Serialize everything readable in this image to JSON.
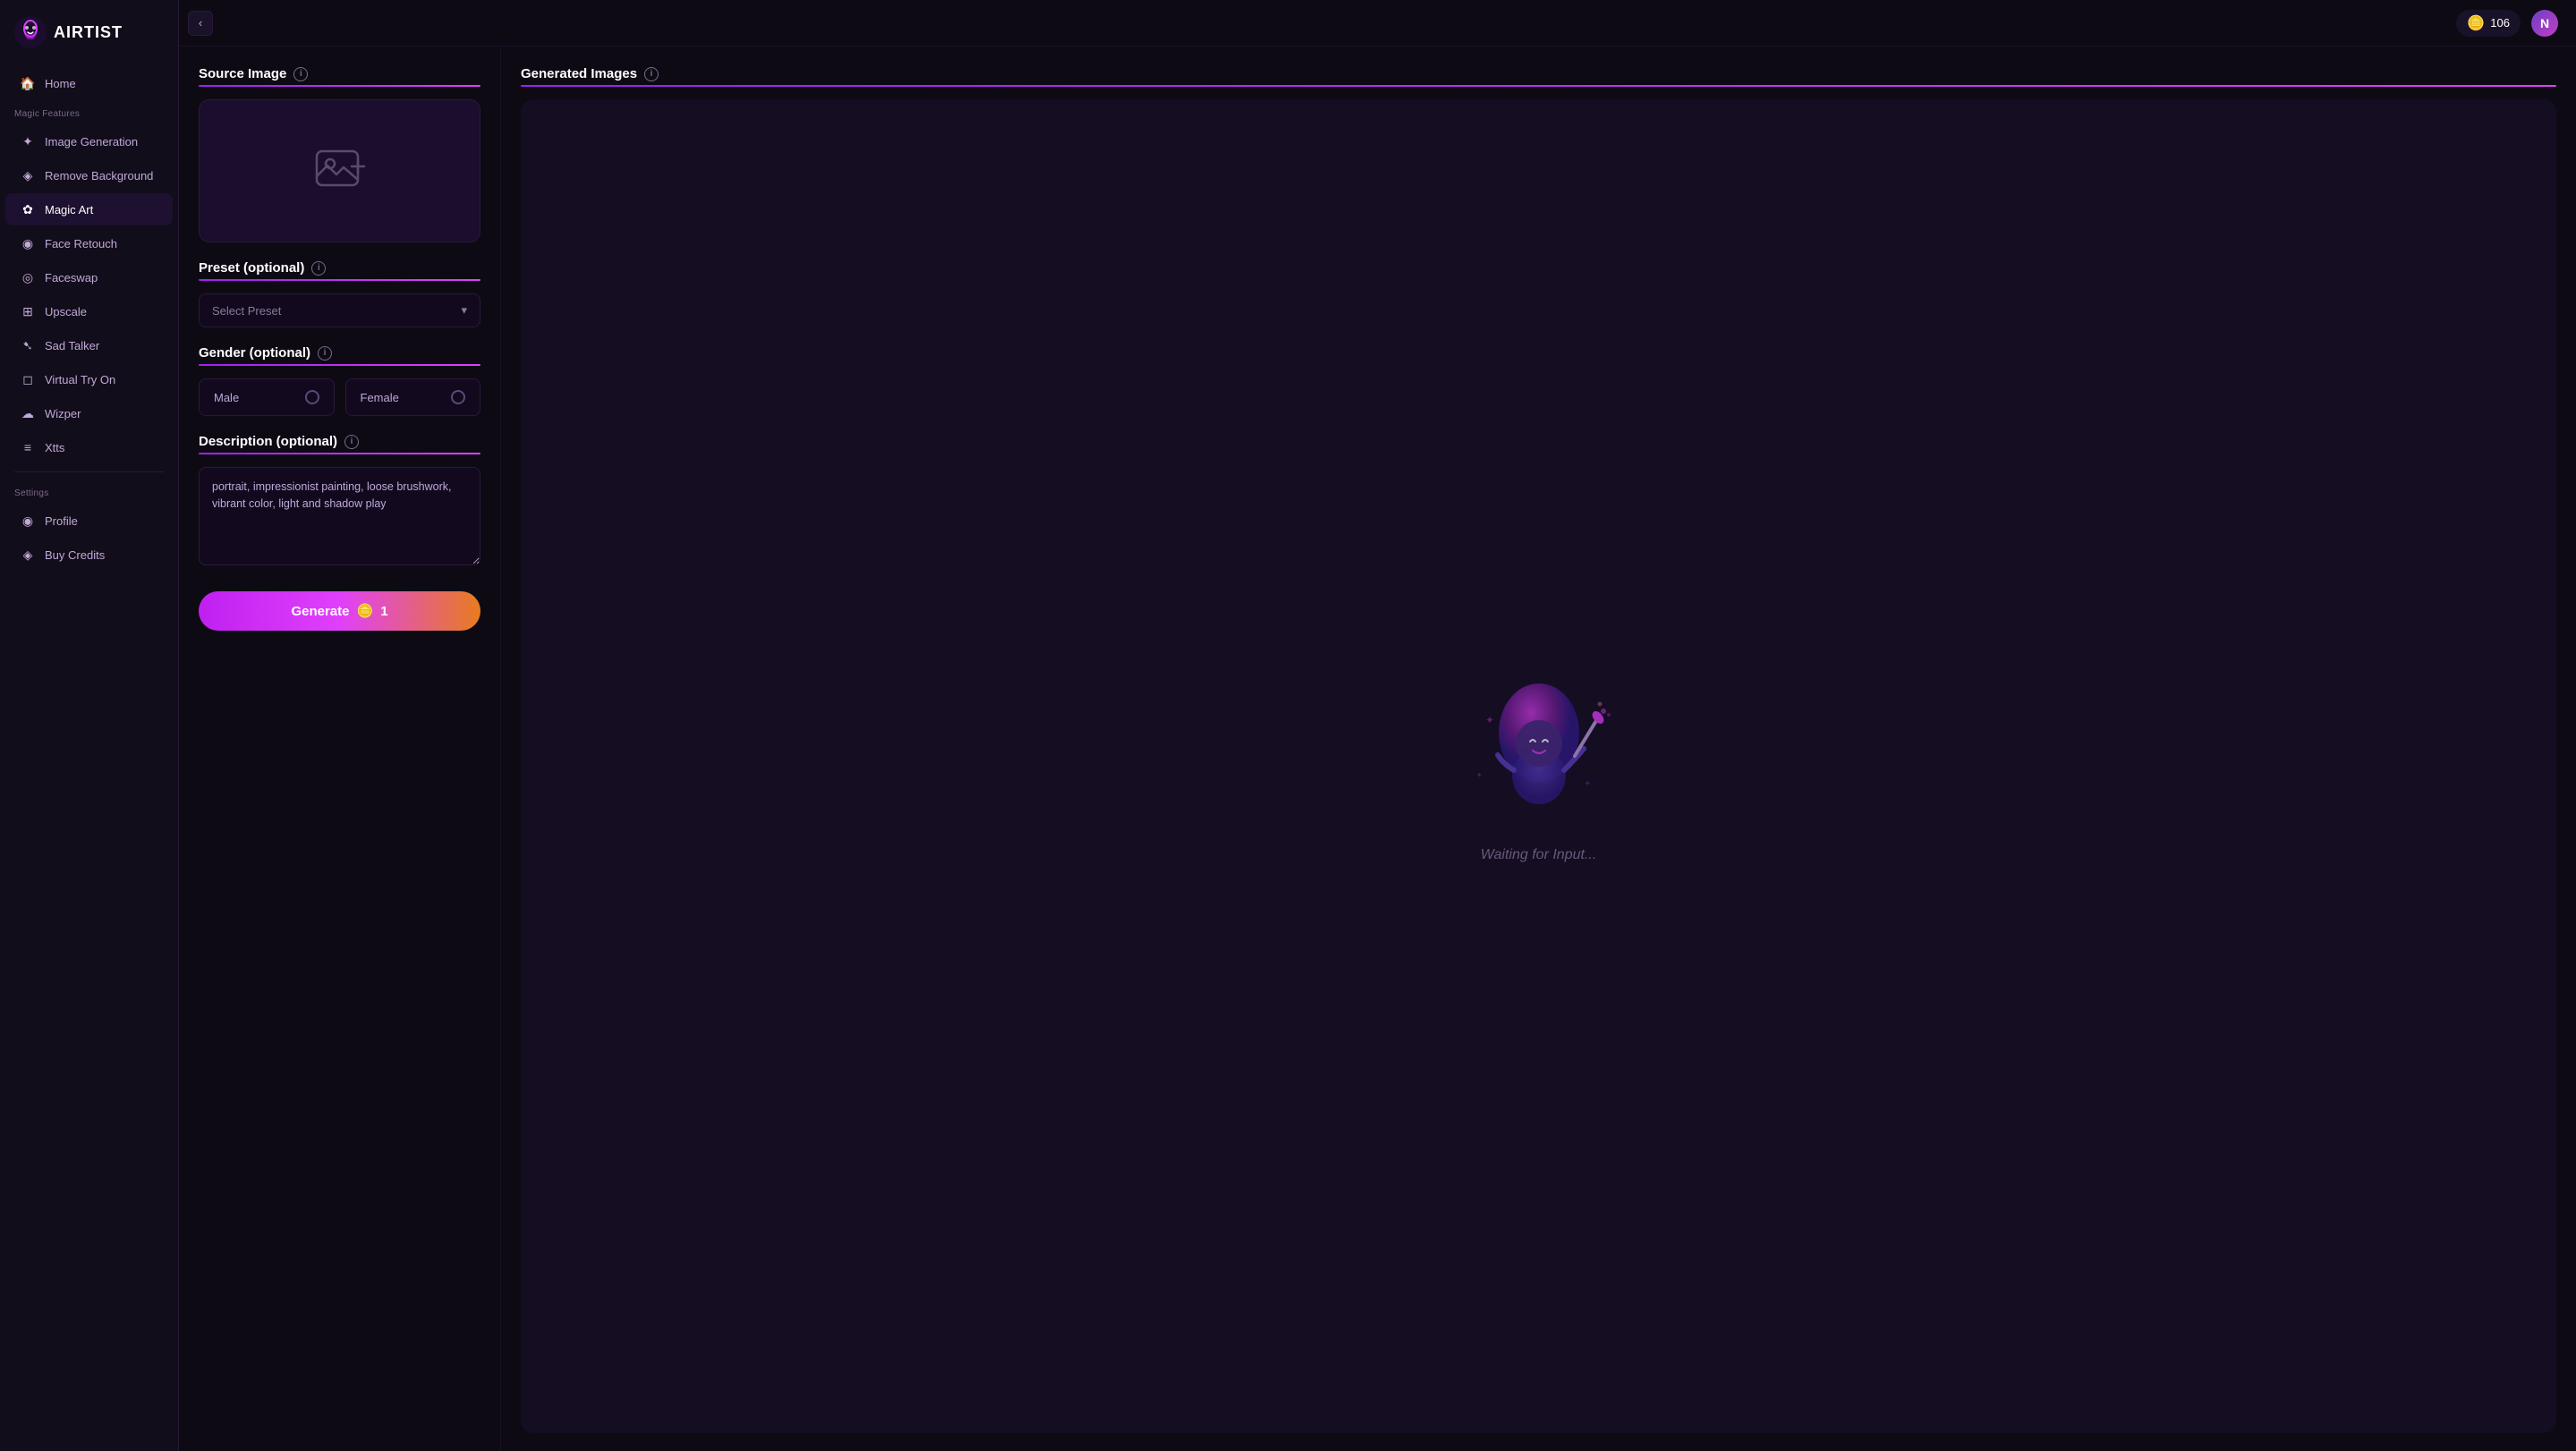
{
  "app": {
    "logo_text": "AIRTIST",
    "credits": "106",
    "user_initial": "N"
  },
  "sidebar": {
    "home_label": "Home",
    "magic_features_label": "Magic Features",
    "items": [
      {
        "id": "image-generation",
        "label": "Image Generation",
        "icon": "✦"
      },
      {
        "id": "remove-background",
        "label": "Remove Background",
        "icon": "◈"
      },
      {
        "id": "magic-art",
        "label": "Magic Art",
        "icon": "✿",
        "active": true
      },
      {
        "id": "face-retouch",
        "label": "Face Retouch",
        "icon": "◉"
      },
      {
        "id": "faceswap",
        "label": "Faceswap",
        "icon": "◎"
      },
      {
        "id": "upscale",
        "label": "Upscale",
        "icon": "⊞"
      },
      {
        "id": "sad-talker",
        "label": "Sad Talker",
        "icon": "➷"
      },
      {
        "id": "virtual-try-on",
        "label": "Virtual Try On",
        "icon": "◻"
      },
      {
        "id": "wizper",
        "label": "Wizper",
        "icon": "☁"
      },
      {
        "id": "xtts",
        "label": "Xtts",
        "icon": "≡"
      }
    ],
    "settings_label": "Settings",
    "settings_items": [
      {
        "id": "profile",
        "label": "Profile",
        "icon": "◉"
      },
      {
        "id": "buy-credits",
        "label": "Buy Credits",
        "icon": "◈"
      }
    ]
  },
  "topbar": {
    "collapse_icon": "‹",
    "credits_icon": "🪙",
    "credits_count": "106"
  },
  "left_panel": {
    "source_image_title": "Source Image",
    "preset_title": "Preset (optional)",
    "preset_placeholder": "Select Preset",
    "gender_title": "Gender (optional)",
    "gender_male": "Male",
    "gender_female": "Female",
    "description_title": "Description (optional)",
    "description_value": "portrait, impressionist painting, loose brushwork, vibrant color, light and shadow play",
    "generate_btn_label": "Generate",
    "generate_btn_cost": "1",
    "generate_btn_emoji": "🪙"
  },
  "right_panel": {
    "title": "Generated Images",
    "waiting_text": "Waiting for Input..."
  }
}
